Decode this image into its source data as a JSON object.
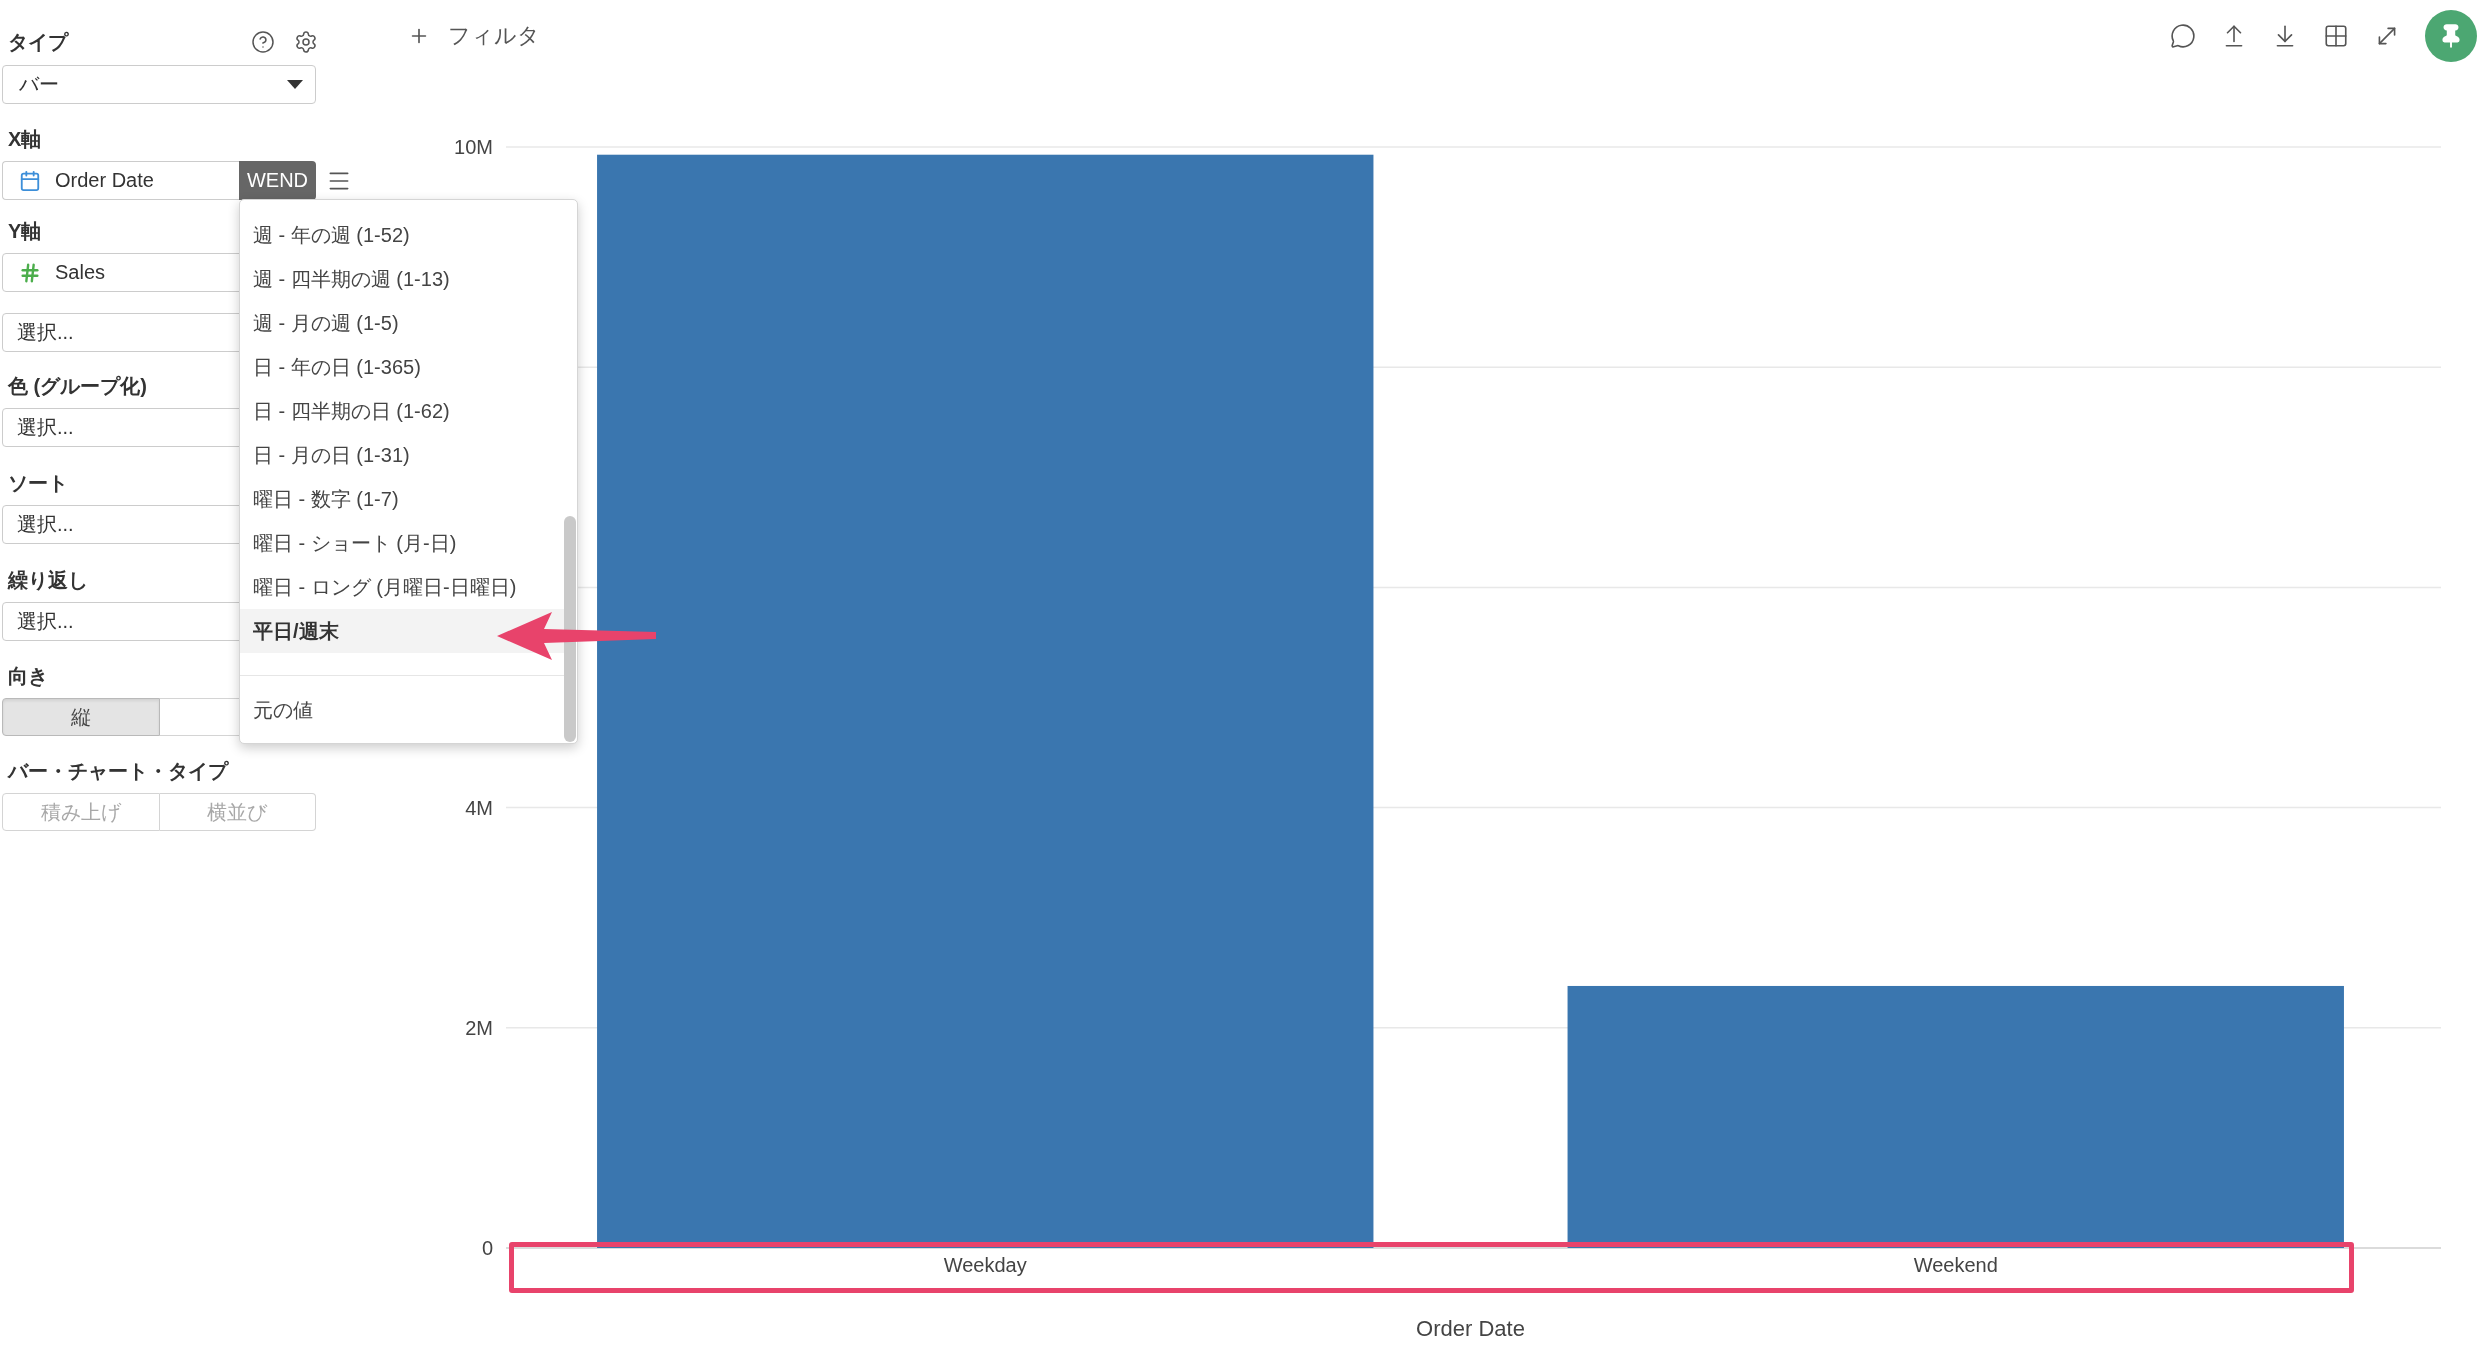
{
  "sidebar": {
    "type": {
      "label": "タイプ",
      "value": "バー"
    },
    "x_axis": {
      "label": "X軸",
      "field": {
        "kind": "date",
        "name": "Order Date",
        "unit": "WEND"
      }
    },
    "y_axis": {
      "label": "Y軸",
      "fields": [
        {
          "kind": "number",
          "name": "Sales"
        }
      ],
      "add": {
        "placeholder": "選択..."
      }
    },
    "pickers": [
      {
        "label": "色 (グループ化)",
        "placeholder": "選択..."
      },
      {
        "label": "ソート",
        "placeholder": "選択..."
      },
      {
        "label": "繰り返し",
        "placeholder": "選択..."
      }
    ],
    "orientation": {
      "label": "向き",
      "options": [
        {
          "label": "縦",
          "selected": true
        },
        {
          "selected": false
        }
      ]
    },
    "bar_chart_type": {
      "label": "バー・チャート・タイプ",
      "disabled": true,
      "options": [
        {
          "label": "積み上げ",
          "selected": false
        },
        {
          "label": "横並び",
          "selected": false
        }
      ]
    }
  },
  "unit_menu": {
    "groups": [
      {
        "items": [
          {
            "label": "週 - 年の週 (1-52)",
            "selected": false
          },
          {
            "label": "週 - 四半期の週 (1-13)",
            "selected": false
          },
          {
            "label": "週 - 月の週 (1-5)",
            "selected": false
          },
          {
            "label": "日 - 年の日 (1-365)",
            "selected": false
          },
          {
            "label": "日 - 四半期の日 (1-62)",
            "selected": false
          },
          {
            "label": "日 - 月の日 (1-31)",
            "selected": false
          },
          {
            "label": "曜日 - 数字 (1-7)",
            "selected": false
          },
          {
            "label": "曜日 - ショート (月-日)",
            "selected": false
          },
          {
            "label": "曜日 - ロング (月曜日-日曜日)",
            "selected": false
          },
          {
            "label": "平日/週末",
            "selected": true
          }
        ]
      },
      {
        "items": [
          {
            "label": "元の値",
            "selected": false
          }
        ]
      }
    ]
  },
  "filter_button": {
    "label": "フィルタ"
  },
  "chart": {
    "chart_data": {
      "type": "bar",
      "xlabel": "Order Date",
      "categories": [
        "Weekday",
        "Weekend"
      ],
      "values": [
        9930000,
        2380000
      ],
      "ylim": [
        0,
        10000000
      ],
      "yticks": [
        {
          "value": 0,
          "label": "0"
        },
        {
          "value": 2000000,
          "label": "2M"
        },
        {
          "value": 4000000,
          "label": "4M"
        },
        {
          "value": 10000000,
          "label": "10M"
        }
      ]
    }
  }
}
